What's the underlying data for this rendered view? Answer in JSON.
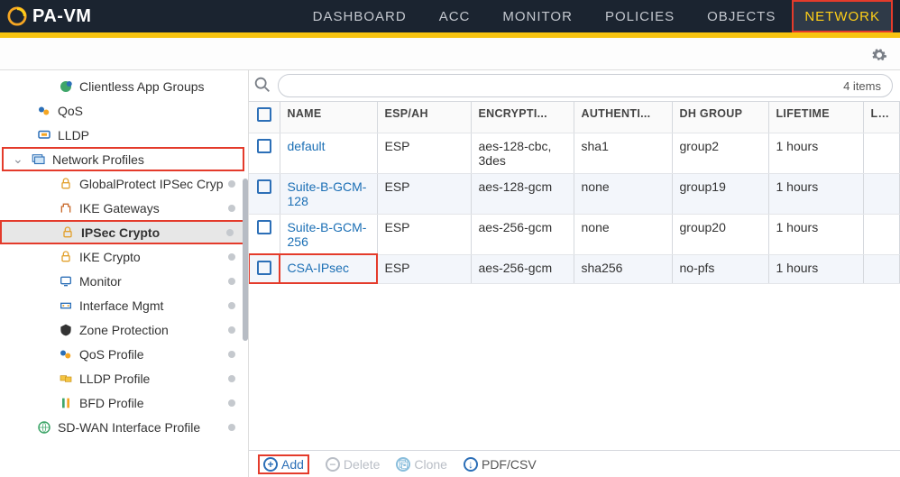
{
  "header": {
    "logo_text": "PA-VM",
    "nav": [
      {
        "label": "DASHBOARD",
        "active": false
      },
      {
        "label": "ACC",
        "active": false
      },
      {
        "label": "MONITOR",
        "active": false
      },
      {
        "label": "POLICIES",
        "active": false
      },
      {
        "label": "OBJECTS",
        "active": false
      },
      {
        "label": "NETWORK",
        "active": true
      }
    ]
  },
  "search": {
    "count_text": "4 items"
  },
  "sidebar": {
    "items": [
      {
        "label": "Clientless App Groups",
        "icon": "app-group-icon",
        "depth": 1
      },
      {
        "label": "QoS",
        "icon": "qos-icon",
        "depth": 0,
        "qos": true
      },
      {
        "label": "LLDP",
        "icon": "lldp-icon",
        "depth": 0,
        "qos": true
      },
      {
        "label": "Network Profiles",
        "icon": "profiles-icon",
        "depth": 0,
        "parent": true,
        "redbox": true,
        "chev": true
      },
      {
        "label": "GlobalProtect IPSec Cryp",
        "icon": "lock-icon",
        "depth": 1,
        "dot": true,
        "truncated": true
      },
      {
        "label": "IKE Gateways",
        "icon": "gateway-icon",
        "depth": 1,
        "dot": true
      },
      {
        "label": "IPSec Crypto",
        "icon": "lock-icon",
        "depth": 1,
        "dot": true,
        "selected": true,
        "redbox": true
      },
      {
        "label": "IKE Crypto",
        "icon": "lock-icon",
        "depth": 1,
        "dot": true
      },
      {
        "label": "Monitor",
        "icon": "monitor-icon",
        "depth": 1,
        "dot": true
      },
      {
        "label": "Interface Mgmt",
        "icon": "interface-icon",
        "depth": 1,
        "dot": true
      },
      {
        "label": "Zone Protection",
        "icon": "zone-icon",
        "depth": 1,
        "dot": true
      },
      {
        "label": "QoS Profile",
        "icon": "qos-icon",
        "depth": 1,
        "dot": true
      },
      {
        "label": "LLDP Profile",
        "icon": "lldp-profile-icon",
        "depth": 1,
        "dot": true
      },
      {
        "label": "BFD Profile",
        "icon": "bfd-icon",
        "depth": 1,
        "dot": true
      },
      {
        "label": "SD-WAN Interface Profile",
        "icon": "sdwan-icon",
        "depth": 0,
        "qos": true,
        "dot": true
      }
    ]
  },
  "table": {
    "columns": [
      "NAME",
      "ESP/AH",
      "ENCRYPTI...",
      "AUTHENTI...",
      "DH GROUP",
      "LIFETIME",
      "LIFE"
    ],
    "rows": [
      {
        "name": "default",
        "espah": "ESP",
        "encrypt": "aes-128-cbc, 3des",
        "auth": "sha1",
        "dh": "group2",
        "life": "1 hours",
        "life2": "",
        "alt": false,
        "red": false
      },
      {
        "name": "Suite-B-GCM-128",
        "espah": "ESP",
        "encrypt": "aes-128-gcm",
        "auth": "none",
        "dh": "group19",
        "life": "1 hours",
        "life2": "",
        "alt": true,
        "red": false
      },
      {
        "name": "Suite-B-GCM-256",
        "espah": "ESP",
        "encrypt": "aes-256-gcm",
        "auth": "none",
        "dh": "group20",
        "life": "1 hours",
        "life2": "",
        "alt": false,
        "red": false
      },
      {
        "name": "CSA-IPsec",
        "espah": "ESP",
        "encrypt": "aes-256-gcm",
        "auth": "sha256",
        "dh": "no-pfs",
        "life": "1 hours",
        "life2": "",
        "alt": true,
        "red": true
      }
    ]
  },
  "footer": {
    "add": "Add",
    "delete": "Delete",
    "clone": "Clone",
    "pdf": "PDF/CSV"
  }
}
